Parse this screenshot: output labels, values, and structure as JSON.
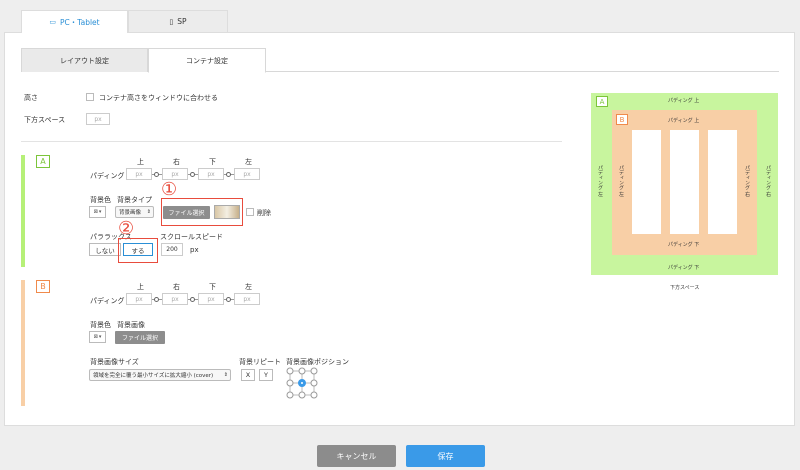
{
  "device_tabs": [
    {
      "label": "PC・Tablet",
      "icon": "monitor-icon",
      "active": true
    },
    {
      "label": "SP",
      "icon": "smartphone-icon",
      "active": false
    }
  ],
  "sub_tabs": [
    {
      "label": "レイアウト設定",
      "active": false
    },
    {
      "label": "コンテナ設定",
      "active": true
    }
  ],
  "height": {
    "label": "高さ",
    "checkbox_label": "コンテナ高さをウィンドウに合わせる"
  },
  "bottom_space": {
    "label": "下方スペース",
    "placeholder": "px"
  },
  "section_a": {
    "badge": "A",
    "color": "#b6f078",
    "badge_color": "#7cc53a",
    "padding_label": "パディング",
    "dirs": [
      "上",
      "右",
      "下",
      "左"
    ],
    "placeholder": "px",
    "bg_color_label": "背景色",
    "bg_type_label": "背景タイプ",
    "bg_type_value": "背景画像",
    "file_button": "ファイル選択",
    "delete_label": "削除",
    "parallax_label": "パララックス",
    "parallax_off": "しない",
    "parallax_on": "する",
    "scroll_speed_label": "スクロールスピード",
    "scroll_speed_value": "200",
    "scroll_speed_unit": "px",
    "callout1": "①",
    "callout2": "②"
  },
  "section_b": {
    "badge": "B",
    "color": "#f8cfa6",
    "badge_color": "#f08a4b",
    "padding_label": "パディング",
    "dirs": [
      "上",
      "右",
      "下",
      "左"
    ],
    "placeholder": "px",
    "bg_color_label": "背景色",
    "bg_image_label": "背景画像",
    "file_button": "ファイル選択",
    "bg_size_label": "背景画像サイズ",
    "bg_size_value": "領域を完全に覆う最小サイズに拡大縮小 (cover)",
    "bg_repeat_label": "背景リピート",
    "repeat_x": "X",
    "repeat_y": "Y",
    "bg_position_label": "背景画像ポジション"
  },
  "preview": {
    "outer_badge": "A",
    "inner_badge": "B",
    "outer_top": "パディング 上",
    "outer_bottom": "パディング 下",
    "outer_left": "パディング 左",
    "outer_right": "パディング 右",
    "inner_top": "パディング 上",
    "inner_bottom": "パディング 下",
    "inner_left": "パディング 左",
    "inner_right": "パディング 右",
    "bottom_space": "下方スペース"
  },
  "footer": {
    "cancel": "キャンセル",
    "save": "保存"
  },
  "colors": {
    "accent": "#2a8fd6",
    "cancel_bg": "#8c8c8c",
    "save_bg": "#3a9ae8",
    "highlight": "#e84c3d"
  }
}
